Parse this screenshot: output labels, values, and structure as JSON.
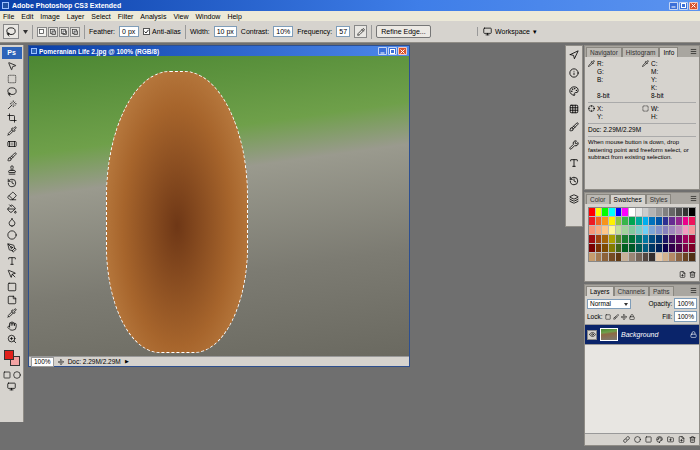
{
  "window": {
    "title": "Adobe Photoshop CS3 Extended"
  },
  "menu": [
    "File",
    "Edit",
    "Image",
    "Layer",
    "Select",
    "Filter",
    "Analysis",
    "View",
    "Window",
    "Help"
  ],
  "options_bar": {
    "feather_label": "Feather:",
    "feather_value": "0 px",
    "anti_alias": {
      "label": "Anti-alias",
      "checked": true
    },
    "width_label": "Width:",
    "width_value": "10 px",
    "contrast_label": "Contrast:",
    "contrast_value": "10%",
    "frequency_label": "Frequency:",
    "frequency_value": "57",
    "refine_edge": "Refine Edge...",
    "workspace": "Workspace",
    "workspace_arrow": "▾"
  },
  "toolbox": {
    "logo": "Ps",
    "foreground": "#e0201b",
    "background": "#f3a3a3"
  },
  "document": {
    "title": "Pomeranian Life 2.jpg @ 100% (RGB/8)",
    "zoom": "100%",
    "status": "Doc: 2.29M/2.29M",
    "status_arrow": "▶"
  },
  "info_panel": {
    "tabs": [
      {
        "label": "Navigator",
        "selected": false
      },
      {
        "label": "Histogram",
        "selected": false
      },
      {
        "label": "Info",
        "selected": true
      }
    ],
    "rgb": [
      "R:",
      "G:",
      "B:"
    ],
    "rgb_depth": "8-bit",
    "cmyk": [
      "C:",
      "M:",
      "Y:",
      "K:"
    ],
    "cmyk_depth": "8-bit",
    "xy": [
      "X:",
      "Y:"
    ],
    "wh": [
      "W:",
      "H:"
    ],
    "doc": "Doc: 2.29M/2.29M",
    "hint": "When mouse button is down, drop fastening point and freeform select, or subtract from existing selection."
  },
  "swatches_panel": {
    "tabs": [
      {
        "label": "Color",
        "selected": false
      },
      {
        "label": "Swatches",
        "selected": true
      },
      {
        "label": "Styles",
        "selected": false
      }
    ],
    "colors": [
      "#ff0000",
      "#ffff00",
      "#00ff00",
      "#00ffff",
      "#0000ff",
      "#ff00ff",
      "#ffffff",
      "#e6e6e6",
      "#cccccc",
      "#b3b3b3",
      "#999999",
      "#808080",
      "#666666",
      "#4d4d4d",
      "#333333",
      "#000000",
      "#ed1c24",
      "#f26522",
      "#f7941d",
      "#fff200",
      "#8dc63f",
      "#39b54a",
      "#00a651",
      "#00a99d",
      "#00aeef",
      "#0072bc",
      "#0054a6",
      "#2e3192",
      "#662d91",
      "#92278f",
      "#ec008c",
      "#ed145b",
      "#f7977a",
      "#f9ad81",
      "#fdc68a",
      "#fff79a",
      "#c4df9b",
      "#a3d39c",
      "#82ca9d",
      "#7bcdc8",
      "#6ecff6",
      "#7ea7d8",
      "#8493ca",
      "#8882be",
      "#a187be",
      "#bc8cbf",
      "#f49ac2",
      "#f6989d",
      "#9e0b0f",
      "#a0410d",
      "#a36209",
      "#aba000",
      "#598527",
      "#1a7b30",
      "#007236",
      "#00746b",
      "#0076a3",
      "#004b80",
      "#003471",
      "#1b1464",
      "#440e62",
      "#630460",
      "#9e005d",
      "#9e0039",
      "#790000",
      "#7b2e00",
      "#7d4900",
      "#827b00",
      "#406618",
      "#005e20",
      "#005826",
      "#005952",
      "#005b7f",
      "#003663",
      "#002157",
      "#0d004c",
      "#32004b",
      "#4b0049",
      "#7b0046",
      "#7a0026",
      "#c69c6d",
      "#a67c52",
      "#8c6239",
      "#754c24",
      "#603913",
      "#c7b299",
      "#998675",
      "#736357",
      "#534741",
      "#362f2d",
      "#e7c9a9",
      "#d3b28f",
      "#b48a66",
      "#8a6241",
      "#6b4423",
      "#4e2f14"
    ]
  },
  "layers_panel": {
    "tabs": [
      {
        "label": "Layers",
        "selected": true
      },
      {
        "label": "Channels",
        "selected": false
      },
      {
        "label": "Paths",
        "selected": false
      }
    ],
    "blend_mode": "Normal",
    "opacity_label": "Opacity:",
    "opacity": "100%",
    "lock_label": "Lock:",
    "fill_label": "Fill:",
    "fill": "100%",
    "layers": [
      {
        "name": "Background",
        "visible": true,
        "selected": true,
        "locked": true
      }
    ]
  }
}
